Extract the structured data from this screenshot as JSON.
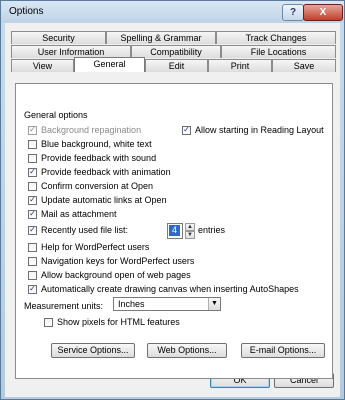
{
  "window": {
    "title": "Options",
    "help_label": "?",
    "close_label": "X"
  },
  "tabs": [
    {
      "label": "Security"
    },
    {
      "label": "Spelling & Grammar"
    },
    {
      "label": "Track Changes"
    },
    {
      "label": "User Information"
    },
    {
      "label": "Compatibility"
    },
    {
      "label": "File Locations"
    },
    {
      "label": "View"
    },
    {
      "label": "General"
    },
    {
      "label": "Edit"
    },
    {
      "label": "Print"
    },
    {
      "label": "Save"
    }
  ],
  "active_tab": "General",
  "general_options": {
    "group_label": "General options",
    "items": [
      {
        "label": "Background repagination",
        "checked": true,
        "disabled": true
      },
      {
        "label": "Allow starting in Reading Layout",
        "checked": true
      },
      {
        "label": "Blue background, white text",
        "checked": false
      },
      {
        "label": "Provide feedback with sound",
        "checked": false
      },
      {
        "label": "Provide feedback with animation",
        "checked": true
      },
      {
        "label": "Confirm conversion at Open",
        "checked": false
      },
      {
        "label": "Update automatic links at Open",
        "checked": true
      },
      {
        "label": "Mail as attachment",
        "checked": true
      },
      {
        "label": "Recently used file list:",
        "checked": true
      },
      {
        "label": "Help for WordPerfect users",
        "checked": false
      },
      {
        "label": "Navigation keys for WordPerfect users",
        "checked": false
      },
      {
        "label": "Allow background open of web pages",
        "checked": false
      },
      {
        "label": "Automatically create drawing canvas when inserting AutoShapes",
        "checked": true
      }
    ],
    "recent_files_count": "4",
    "entries_label": "entries",
    "measurement_label": "Measurement units:",
    "measurement_value": "Inches",
    "show_pixels": {
      "label": "Show pixels for HTML features",
      "checked": false
    }
  },
  "buttons": {
    "service_options": "Service Options...",
    "web_options": "Web Options...",
    "email_options": "E-mail Options...",
    "ok": "OK",
    "cancel": "Cancel"
  },
  "glyphs": {
    "check": "✓",
    "spin_up": "▲",
    "spin_down": "▼",
    "dropdown": "▼"
  }
}
